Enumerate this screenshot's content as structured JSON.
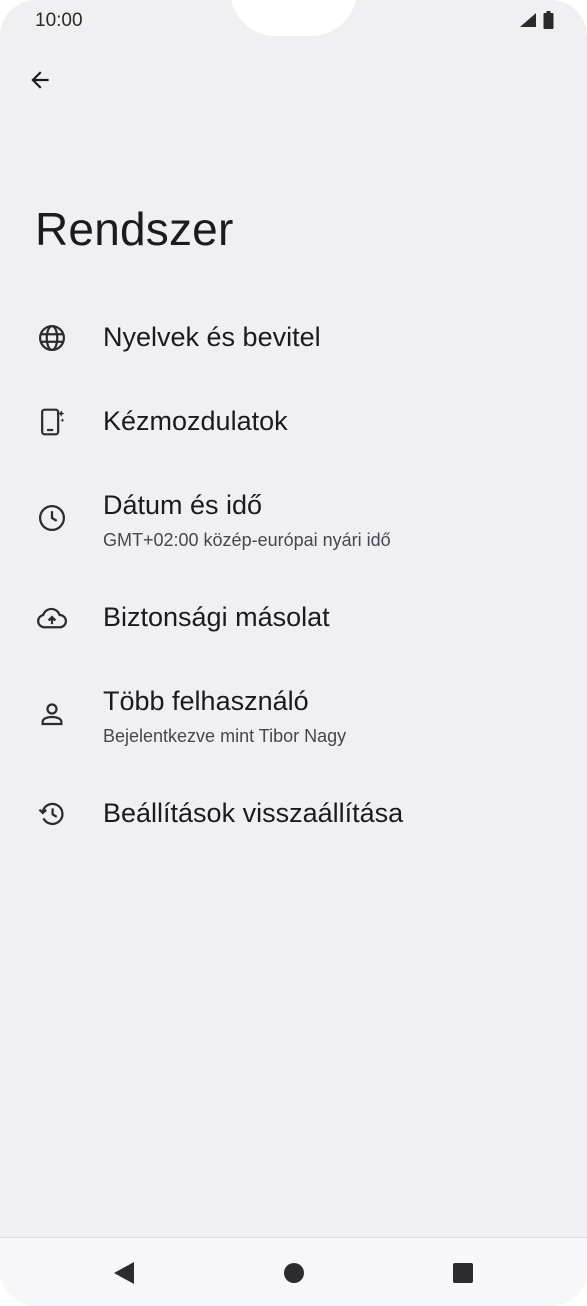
{
  "status_bar": {
    "time": "10:00",
    "icons": [
      "signal-icon",
      "battery-icon"
    ]
  },
  "header": {
    "back_icon": "arrow-left-icon",
    "title": "Rendszer"
  },
  "items": [
    {
      "icon": "globe-icon",
      "title": "Nyelvek és bevitel",
      "subtitle": ""
    },
    {
      "icon": "phone-gesture-icon",
      "title": "Kézmozdulatok",
      "subtitle": ""
    },
    {
      "icon": "clock-icon",
      "title": "Dátum és idő",
      "subtitle": "GMT+02:00 közép-európai nyári idő"
    },
    {
      "icon": "cloud-upload-icon",
      "title": "Biztonsági másolat",
      "subtitle": ""
    },
    {
      "icon": "person-icon",
      "title": "Több felhasználó",
      "subtitle": "Bejelentkezve mint Tibor Nagy"
    },
    {
      "icon": "history-icon",
      "title": "Beállítások visszaállítása",
      "subtitle": ""
    }
  ],
  "nav_bar": {
    "back": "nav-back-icon",
    "home": "nav-home-icon",
    "recents": "nav-recents-icon"
  },
  "colors": {
    "background": "#f0f0f3",
    "text_primary": "#1b1b1f",
    "text_secondary": "#45464f",
    "icon": "#2c2c30"
  }
}
